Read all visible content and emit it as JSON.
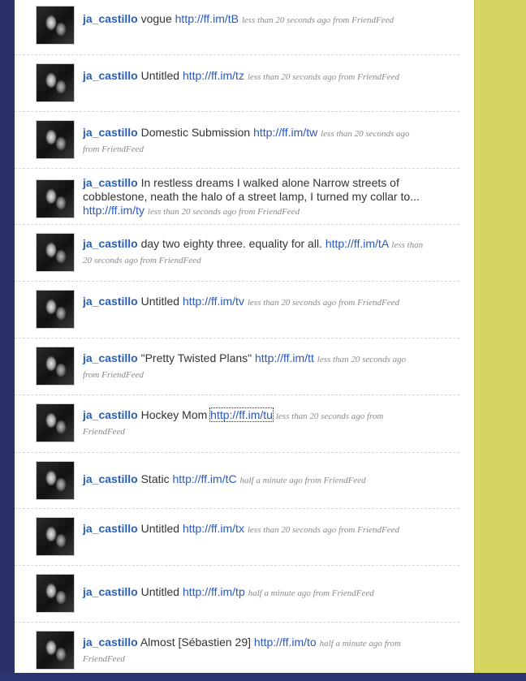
{
  "timeline": [
    {
      "user": "ja_castillo",
      "text": "vogue",
      "link": "http://ff.im/tB",
      "meta": "less than 20 seconds ago from FriendFeed"
    },
    {
      "user": "ja_castillo",
      "text": "Untitled",
      "link": "http://ff.im/tz",
      "meta": "less than 20 seconds ago from FriendFeed"
    },
    {
      "user": "ja_castillo",
      "text": "Domestic Submission",
      "link": "http://ff.im/tw",
      "meta": "less than 20 seconds ago from FriendFeed"
    },
    {
      "user": "ja_castillo",
      "text": "In restless dreams I walked alone Narrow streets of cobblestone, neath the halo of a street lamp, I turned my collar to...",
      "link": "http://ff.im/ty",
      "meta": "less than 20 seconds ago from FriendFeed"
    },
    {
      "user": "ja_castillo",
      "text": "day two eighty three. equality for all.",
      "link": "http://ff.im/tA",
      "meta": "less than 20 seconds ago from FriendFeed"
    },
    {
      "user": "ja_castillo",
      "text": "Untitled",
      "link": "http://ff.im/tv",
      "meta": "less than 20 seconds ago from FriendFeed"
    },
    {
      "user": "ja_castillo",
      "text": "\"Pretty Twisted Plans\"",
      "link": "http://ff.im/tt",
      "meta": "less than 20 seconds ago from FriendFeed"
    },
    {
      "user": "ja_castillo",
      "text": "Hockey Mom",
      "link": "http://ff.im/tu",
      "meta": "less than 20 seconds ago from FriendFeed"
    },
    {
      "user": "ja_castillo",
      "text": "Static",
      "link": "http://ff.im/tC",
      "meta": "half a minute ago from FriendFeed"
    },
    {
      "user": "ja_castillo",
      "text": "Untitled",
      "link": "http://ff.im/tx",
      "meta": "less than 20 seconds ago from FriendFeed"
    },
    {
      "user": "ja_castillo",
      "text": "Untitled",
      "link": "http://ff.im/tp",
      "meta": "half a minute ago from FriendFeed"
    },
    {
      "user": "ja_castillo",
      "text": "Almost [Sébastien 29]",
      "link": "http://ff.im/to",
      "meta": "half a minute ago from FriendFeed"
    }
  ]
}
